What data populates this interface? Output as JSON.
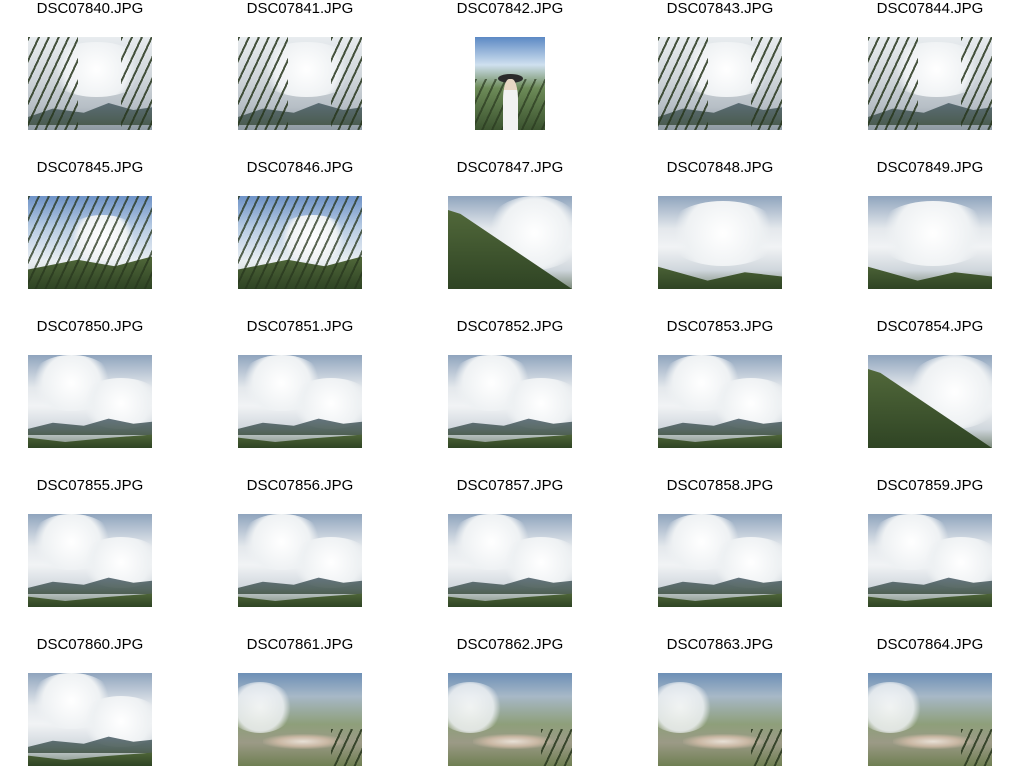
{
  "thumbnails": [
    {
      "filename": "DSC07840.JPG",
      "scene": "fog-foliage"
    },
    {
      "filename": "DSC07841.JPG",
      "scene": "fog-foliage"
    },
    {
      "filename": "DSC07842.JPG",
      "scene": "person"
    },
    {
      "filename": "DSC07843.JPG",
      "scene": "fog-foliage"
    },
    {
      "filename": "DSC07844.JPG",
      "scene": "fog-foliage"
    },
    {
      "filename": "DSC07845.JPG",
      "scene": "blue-foliage"
    },
    {
      "filename": "DSC07846.JPG",
      "scene": "blue-foliage"
    },
    {
      "filename": "DSC07847.JPG",
      "scene": "slope-cloud"
    },
    {
      "filename": "DSC07848.JPG",
      "scene": "cloud-hill"
    },
    {
      "filename": "DSC07849.JPG",
      "scene": "cloud-hill"
    },
    {
      "filename": "DSC07850.JPG",
      "scene": "cloud-ridge"
    },
    {
      "filename": "DSC07851.JPG",
      "scene": "cloud-ridge"
    },
    {
      "filename": "DSC07852.JPG",
      "scene": "cloud-ridge"
    },
    {
      "filename": "DSC07853.JPG",
      "scene": "cloud-ridge"
    },
    {
      "filename": "DSC07854.JPG",
      "scene": "slope-cloud"
    },
    {
      "filename": "DSC07855.JPG",
      "scene": "cloud-ridge"
    },
    {
      "filename": "DSC07856.JPG",
      "scene": "cloud-ridge"
    },
    {
      "filename": "DSC07857.JPG",
      "scene": "cloud-ridge"
    },
    {
      "filename": "DSC07858.JPG",
      "scene": "cloud-ridge"
    },
    {
      "filename": "DSC07859.JPG",
      "scene": "cloud-ridge"
    },
    {
      "filename": "DSC07860.JPG",
      "scene": "cloud-ridge"
    },
    {
      "filename": "DSC07861.JPG",
      "scene": "valley-town"
    },
    {
      "filename": "DSC07862.JPG",
      "scene": "valley-town"
    },
    {
      "filename": "DSC07863.JPG",
      "scene": "valley-town"
    },
    {
      "filename": "DSC07864.JPG",
      "scene": "valley-town"
    }
  ]
}
